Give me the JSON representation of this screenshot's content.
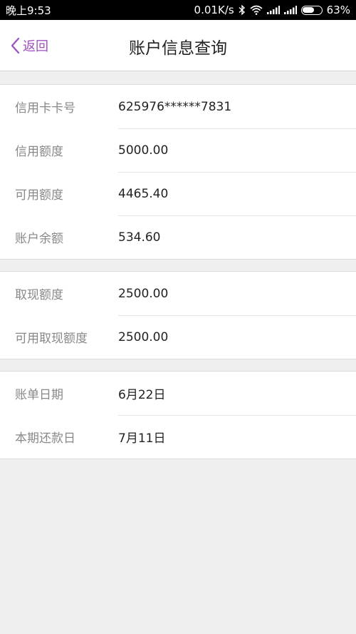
{
  "status_bar": {
    "time": "晚上9:53",
    "network_speed": "0.01K/s",
    "battery_percent": "63%",
    "battery_level": 0.63,
    "icons": [
      "bluetooth-icon",
      "wifi-icon",
      "signal-icon",
      "signal-icon",
      "battery-icon"
    ]
  },
  "header": {
    "back_label": "返回",
    "title": "账户信息查询"
  },
  "sections": [
    {
      "rows": [
        {
          "label": "信用卡卡号",
          "value": "625976******7831"
        },
        {
          "label": "信用额度",
          "value": "5000.00"
        },
        {
          "label": "可用额度",
          "value": "4465.40"
        },
        {
          "label": "账户余额",
          "value": "534.60"
        }
      ]
    },
    {
      "rows": [
        {
          "label": "取现额度",
          "value": "2500.00"
        },
        {
          "label": "可用取现额度",
          "value": "2500.00"
        }
      ]
    },
    {
      "rows": [
        {
          "label": "账单日期",
          "value": "6月22日"
        },
        {
          "label": "本期还款日",
          "value": "7月11日"
        }
      ]
    }
  ],
  "colors": {
    "accent": "#9d4fc0",
    "background": "#efeff0"
  }
}
